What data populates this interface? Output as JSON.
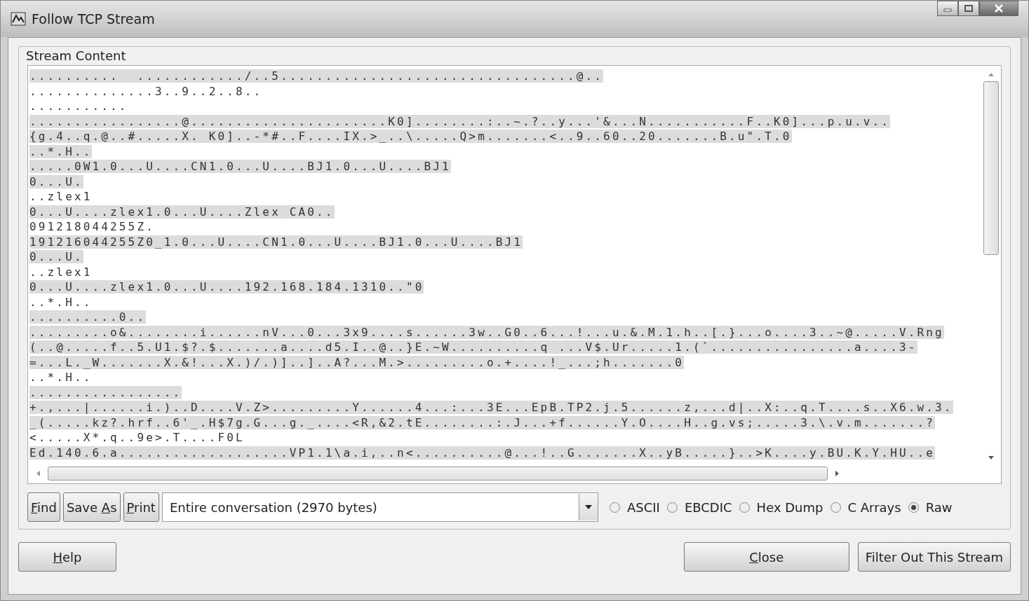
{
  "window": {
    "title": "Follow TCP Stream"
  },
  "group": {
    "title": "Stream Content"
  },
  "stream_lines": [
    {
      "text": "..........  ............/..5.................................@..",
      "highlighted": true
    },
    {
      "text": "..............3..9..2..8..",
      "highlighted": false
    },
    {
      "text": "...........",
      "highlighted": false
    },
    {
      "text": ".................@......................K0]........:..~.?..y...'&...N...........F..K0]...p.u.v..",
      "highlighted": true
    },
    {
      "text": "{g.4..q.@..#.....X. K0]..-*#..F....IX.>_..\\.....Q>m.......<..9..60..20.......B.u\".T.0",
      "highlighted": true
    },
    {
      "text": "..*.H..",
      "highlighted": true
    },
    {
      "text": ".....0W1.0...U....CN1.0...U....BJ1.0...U....BJ1",
      "highlighted": true
    },
    {
      "text": "0...U.",
      "highlighted": true
    },
    {
      "text": "..zlex1",
      "highlighted": false
    },
    {
      "text": "0...U....zlex1.0...U....Zlex CA0..",
      "highlighted": true
    },
    {
      "text": "091218044255Z.",
      "highlighted": false
    },
    {
      "text": "191216044255Z0_1.0...U....CN1.0...U....BJ1.0...U....BJ1",
      "highlighted": true
    },
    {
      "text": "0...U.",
      "highlighted": true
    },
    {
      "text": "..zlex1",
      "highlighted": false
    },
    {
      "text": "0...U....zlex1.0...U....192.168.184.1310..\"0",
      "highlighted": true
    },
    {
      "text": "..*.H..",
      "highlighted": false
    },
    {
      "text": "..........0..",
      "highlighted": true
    },
    {
      "text": ".........o&........i......nV...0...3x9....s......3w..G0..6...!...u.&.M.1.h..[.}...o....3..~@.....V.Rng",
      "highlighted": true
    },
    {
      "text": "(..@.....f..5.U1.$?.$.......a....d5.I..@..}E.~W..........q ...V$.Ur.....1.(`................a....3-",
      "highlighted": true
    },
    {
      "text": "=...L._W.......X.&!...X.)/.)]..]..A?...M.>.........o.+....!_...;h.......0",
      "highlighted": true
    },
    {
      "text": "..*.H..",
      "highlighted": false
    },
    {
      "text": ".................",
      "highlighted": true
    },
    {
      "text": "+.,...|......i.)..D....V.Z>.........Y......4...:...3E...EpB.TP2.j.5......z,...d|..X:..q.T....s..X6.w.3.",
      "highlighted": true
    },
    {
      "text": "_(.....kz?.hrf..6'_.H$7g.G...g._....<R,&2.tE........:.J...+f......Y.O....H..g.vs;.....3.\\.v.m.......?",
      "highlighted": true
    },
    {
      "text": "<.....X*.q..9e>.T....F0L",
      "highlighted": false
    },
    {
      "text": "Ed.140.6.a...................VP1.1\\a.i,..n<..........@...!..G.......X..yB.....}..>K....y.BU.K.Y.HU..e",
      "highlighted": true
    }
  ],
  "tool_buttons": [
    {
      "underlined": "F",
      "rest": "ind"
    },
    {
      "before": "Save ",
      "underlined": "A",
      "rest": "s"
    },
    {
      "underlined": "P",
      "rest": "rint"
    }
  ],
  "dropdown": {
    "value": "Entire conversation (2970 bytes)"
  },
  "formats": [
    {
      "label": "ASCII",
      "selected": false
    },
    {
      "label": "EBCDIC",
      "selected": false
    },
    {
      "label": "Hex Dump",
      "selected": false
    },
    {
      "label": "C Arrays",
      "selected": false
    },
    {
      "label": "Raw",
      "selected": true
    }
  ],
  "footer_buttons": [
    {
      "underlined": "H",
      "rest": "elp"
    },
    {
      "underlined": "C",
      "rest": "lose"
    },
    {
      "rest": "Filter Out This Stream"
    }
  ]
}
